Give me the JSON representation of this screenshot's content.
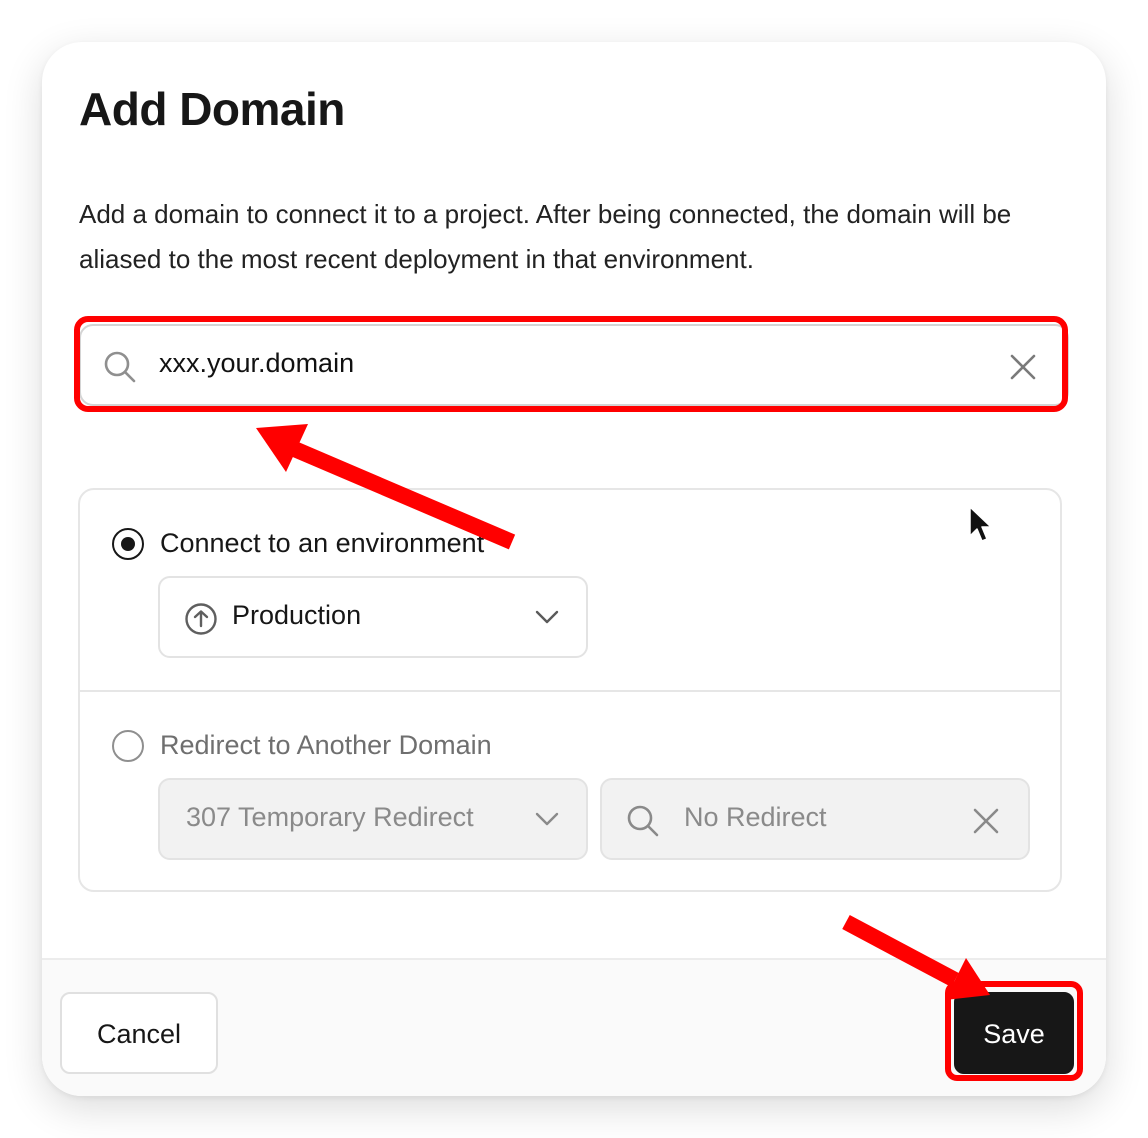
{
  "dialog": {
    "title": "Add Domain",
    "description": "Add a domain to connect it to a project. After being connected, the domain will be aliased to the most recent deployment in that environment."
  },
  "domain_input": {
    "value": "xxx.your.domain",
    "icon": "search-icon",
    "clear_icon": "close-icon"
  },
  "options": {
    "connect": {
      "label": "Connect to an environment",
      "selected": true,
      "environment": {
        "value": "Production",
        "icon": "arrow-up-circle-icon"
      }
    },
    "redirect": {
      "label": "Redirect to Another Domain",
      "selected": false,
      "status_code": {
        "value": "307 Temporary Redirect"
      },
      "target": {
        "placeholder": "No Redirect"
      }
    }
  },
  "footer": {
    "cancel_label": "Cancel",
    "save_label": "Save"
  },
  "colors": {
    "annotation": "#ff0000",
    "primary_button": "#171717"
  }
}
